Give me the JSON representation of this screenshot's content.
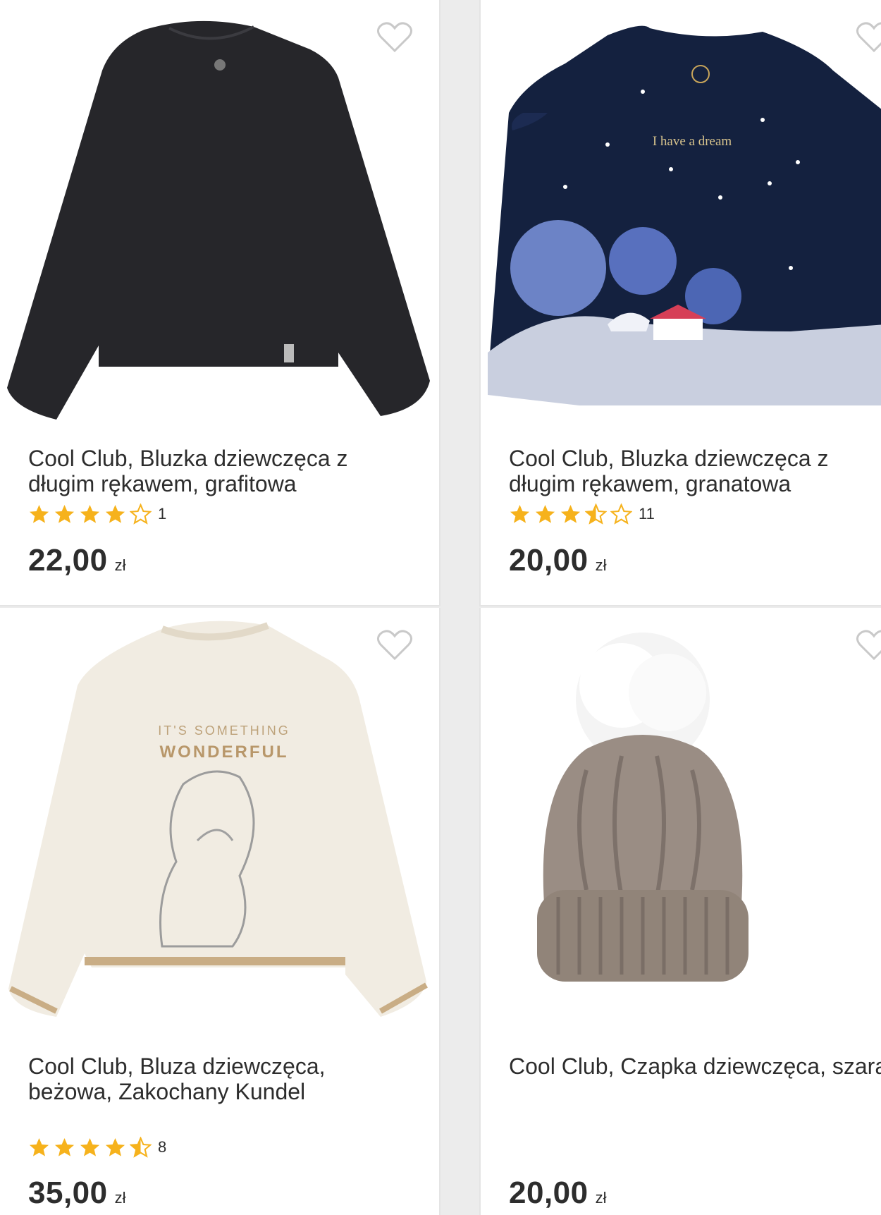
{
  "products": [
    {
      "title": "Cool Club, Bluzka dziewczęca z długim rękawem, grafitowa",
      "rating": 4,
      "rating_count": "1",
      "price": "22,00",
      "currency": "zł",
      "image_icon": "black-long-sleeve-top-image",
      "color": "#26262a"
    },
    {
      "title": "Cool Club, Bluzka dziewczęca z długim rękawem, granatowa",
      "rating": 3.5,
      "rating_count": "11",
      "price": "20,00",
      "currency": "zł",
      "image_icon": "navy-top-winter-print-image",
      "color": "#14213f",
      "print_text": "I have a dream"
    },
    {
      "title": "Cool Club, Bluza dziewczęca, beżowa, Zakochany Kundel",
      "rating": 4.5,
      "rating_count": "8",
      "price": "35,00",
      "currency": "zł",
      "image_icon": "beige-sweatshirt-lady-tramp-image",
      "color": "#f1ece2",
      "print_line1": "IT'S SOMETHING",
      "print_line2": "WONDERFUL"
    },
    {
      "title": "Cool Club, Czapka dziewczęca, szara",
      "rating": null,
      "rating_count": "",
      "price": "20,00",
      "currency": "zł",
      "image_icon": "grey-knit-pompom-hat-image",
      "color": "#8e8178"
    }
  ],
  "colors": {
    "star_fill": "#f6b21c",
    "text": "#2d2d2d",
    "heart_stroke": "#c9c9c9"
  }
}
